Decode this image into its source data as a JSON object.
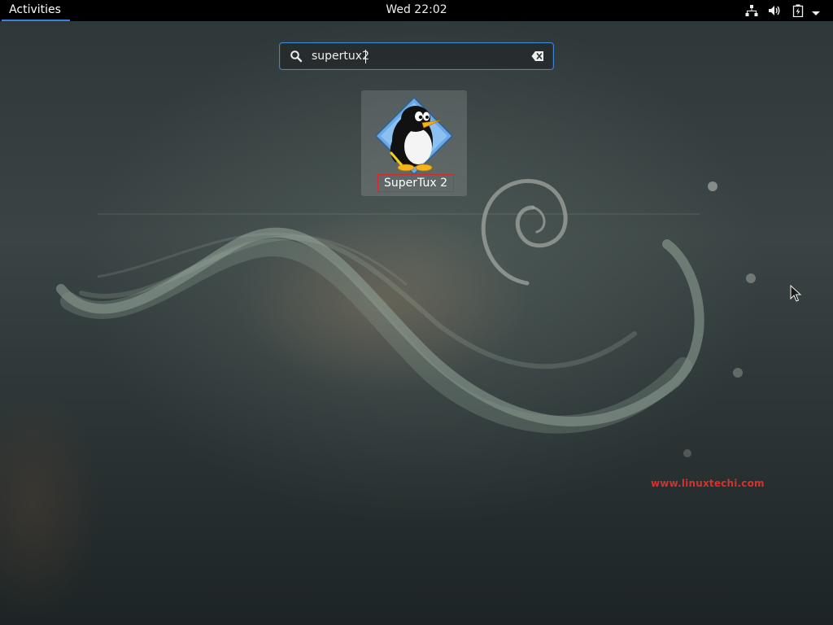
{
  "topbar": {
    "activities_label": "Activities",
    "clock": "Wed 22:02",
    "tray_icons": [
      "network-wired-icon",
      "volume-icon",
      "battery-charging-icon",
      "system-menu-arrow-icon"
    ]
  },
  "search": {
    "value": "supertux2",
    "search_icon": "search-icon",
    "clear_icon": "clear-text-icon"
  },
  "results": [
    {
      "name": "SuperTux 2",
      "icon": "supertux-penguin-icon"
    }
  ],
  "watermark": "www.linuxtechi.com",
  "colors": {
    "accent": "#3584e4",
    "highlight_box": "#d22a2a",
    "watermark": "#d4322c",
    "topbar": "#000000"
  }
}
